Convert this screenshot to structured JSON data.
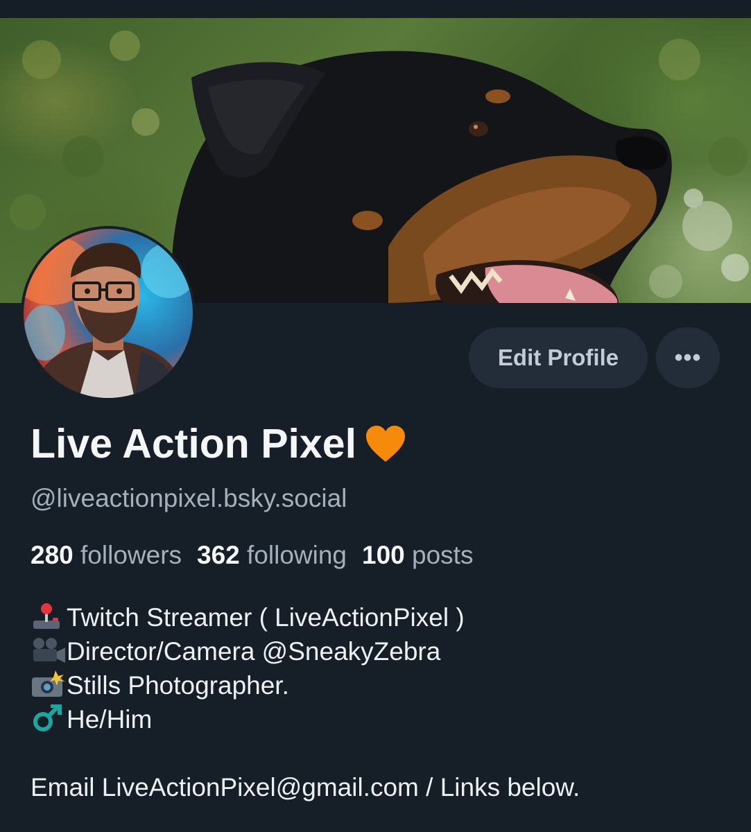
{
  "profile": {
    "display_name": "Live Action Pixel",
    "name_emoji": "orange-heart",
    "handle": "@liveactionpixel.bsky.social",
    "banner_description_icon": "dog-banner-image",
    "avatar_icon": "avatar-photo"
  },
  "actions": {
    "edit_profile_label": "Edit Profile",
    "more_label": "•••"
  },
  "stats": {
    "followers_count": "280",
    "followers_label": "followers",
    "following_count": "362",
    "following_label": "following",
    "posts_count": "100",
    "posts_label": "posts"
  },
  "bio": {
    "line1": {
      "icon": "joystick-icon",
      "text": "Twitch Streamer ( LiveActionPixel )"
    },
    "line2": {
      "icon": "movie-camera-icon",
      "text": "Director/Camera @SneakyZebra"
    },
    "line3": {
      "icon": "camera-flash-icon",
      "text": "Stills Photographer."
    },
    "line4": {
      "icon": "male-sign-icon",
      "text": "He/Him"
    },
    "line5": {
      "text": "Email LiveActionPixel@gmail.com / Links below."
    }
  },
  "colors": {
    "background": "#161e27",
    "button_bg": "#222d39",
    "muted_text": "#a4b0bc",
    "primary_text": "#f4f6f8",
    "heart": "#f58a0b"
  }
}
